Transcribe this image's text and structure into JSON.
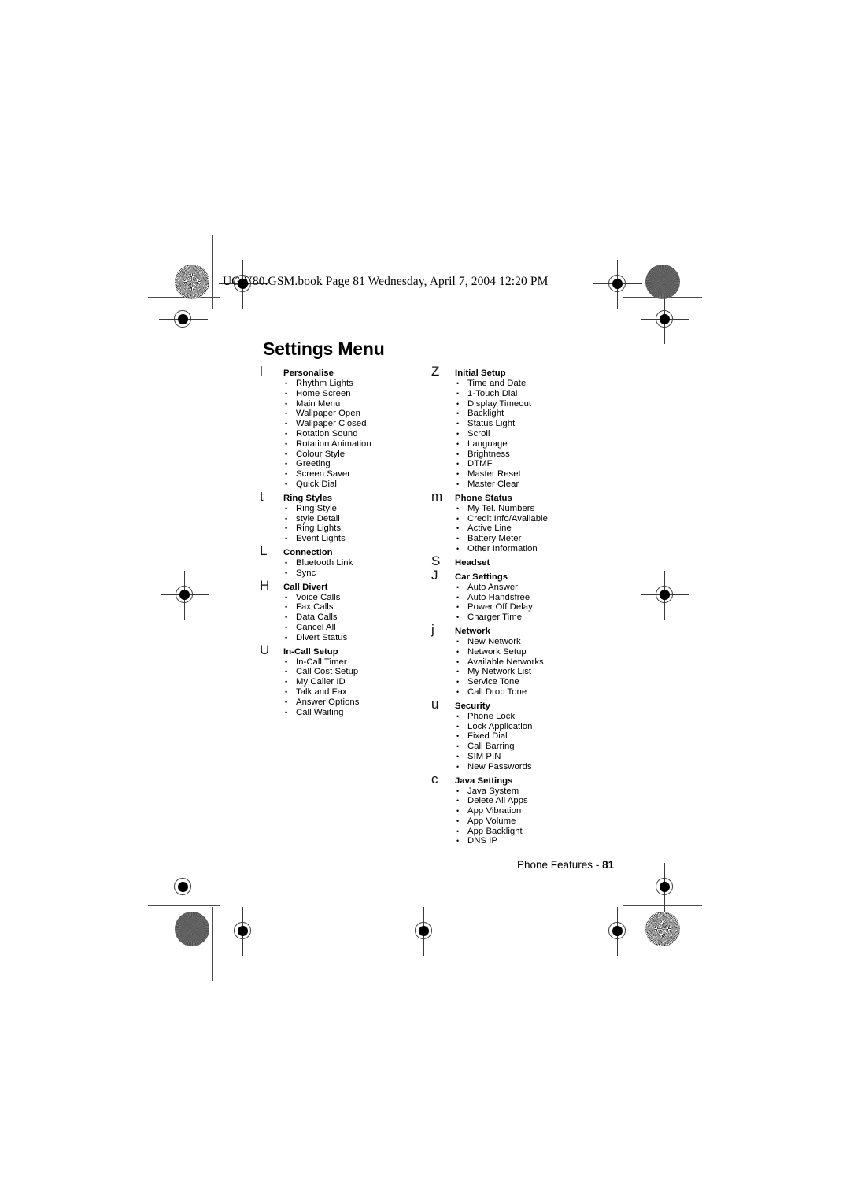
{
  "document": {
    "header_line": "UG.V80.GSM.book  Page 81  Wednesday, April 7, 2004  12:20 PM",
    "title": "Settings Menu",
    "footer_label": "Phone Features - ",
    "footer_page": "81"
  },
  "columns": {
    "left": [
      {
        "icon_glyph": "l",
        "icon_name": "personalise-menu-icon",
        "name": "Personalise",
        "items": [
          "Rhythm Lights",
          "Home Screen",
          "Main Menu",
          "Wallpaper Open",
          "Wallpaper Closed",
          "Rotation Sound",
          "Rotation Animation",
          "Colour Style",
          "Greeting",
          "Screen Saver",
          "Quick Dial"
        ]
      },
      {
        "icon_glyph": "t",
        "icon_name": "ring-styles-menu-icon",
        "name": "Ring Styles",
        "items": [
          "Ring Style",
          "style Detail",
          "Ring Lights",
          "Event Lights"
        ]
      },
      {
        "icon_glyph": "L",
        "icon_name": "connection-menu-icon",
        "name": "Connection",
        "items": [
          "Bluetooth Link",
          "Sync"
        ]
      },
      {
        "icon_glyph": "H",
        "icon_name": "call-divert-menu-icon",
        "name": "Call Divert",
        "items": [
          "Voice Calls",
          "Fax Calls",
          "Data Calls",
          "Cancel All",
          "Divert Status"
        ]
      },
      {
        "icon_glyph": "U",
        "icon_name": "in-call-setup-menu-icon",
        "name": "In-Call Setup",
        "items": [
          "In-Call Timer",
          "Call Cost Setup",
          "My Caller ID",
          "Talk and Fax",
          "Answer Options",
          "Call Waiting"
        ]
      }
    ],
    "right": [
      {
        "icon_glyph": "Z",
        "icon_name": "initial-setup-menu-icon",
        "name": "Initial Setup",
        "items": [
          "Time and Date",
          "1-Touch Dial",
          "Display Timeout",
          "Backlight",
          "Status Light",
          "Scroll",
          "Language",
          "Brightness",
          "DTMF",
          "Master Reset",
          "Master Clear"
        ]
      },
      {
        "icon_glyph": "m",
        "icon_name": "phone-status-menu-icon",
        "name": "Phone Status",
        "items": [
          "My Tel. Numbers",
          "Credit Info/Available",
          "Active Line",
          "Battery Meter",
          "Other Information"
        ]
      },
      {
        "icon_glyph": "S",
        "icon_name": "headset-menu-icon",
        "name": "Headset",
        "items": []
      },
      {
        "icon_glyph": "J",
        "icon_name": "car-settings-menu-icon",
        "name": "Car Settings",
        "items": [
          "Auto Answer",
          "Auto Handsfree",
          "Power Off Delay",
          "Charger Time"
        ]
      },
      {
        "icon_glyph": "j",
        "icon_name": "network-menu-icon",
        "name": "Network",
        "items": [
          "New Network",
          "Network Setup",
          "Available Networks",
          "My Network List",
          "Service Tone",
          "Call Drop Tone"
        ]
      },
      {
        "icon_glyph": "u",
        "icon_name": "security-menu-icon",
        "name": "Security",
        "items": [
          "Phone Lock",
          "Lock Application",
          "Fixed Dial",
          "Call Barring",
          "SIM PIN",
          "New Passwords"
        ]
      },
      {
        "icon_glyph": "c",
        "icon_name": "java-settings-menu-icon",
        "name": "Java Settings",
        "items": [
          "Java System",
          "Delete All Apps",
          "App Vibration",
          "App Volume",
          "App Backlight",
          "DNS IP"
        ]
      }
    ]
  },
  "bullet_glyph": "•"
}
